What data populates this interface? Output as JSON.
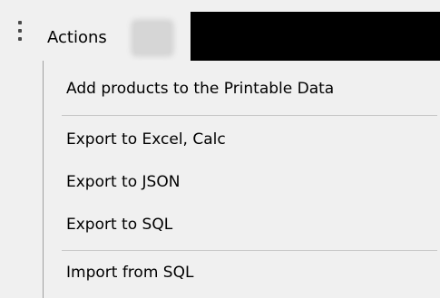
{
  "toolbar": {
    "actions_label": "Actions"
  },
  "menu": {
    "items": [
      {
        "label": "Add products to the Printable Data"
      },
      {
        "label": "Export to Excel, Calc"
      },
      {
        "label": "Export to JSON"
      },
      {
        "label": "Export to SQL"
      },
      {
        "label": "Import from SQL"
      }
    ]
  },
  "icons": {
    "grip": "vertical-ellipsis-icon"
  }
}
